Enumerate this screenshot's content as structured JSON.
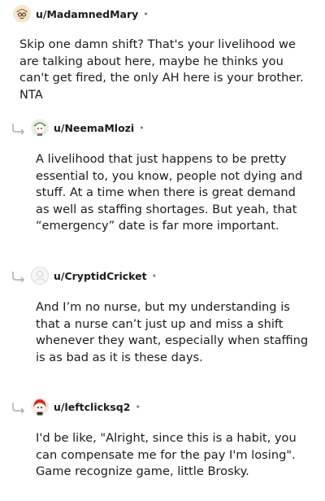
{
  "comments": [
    {
      "username": "u/MadamnedMary",
      "separator": "•",
      "avatar_icon": "snoo-avatar-glasses-icon",
      "text": "Skip one damn shift? That's your livelihood we are talking about here, maybe he thinks you can't get fired, the only AH here is your brother. NTA"
    },
    {
      "username": "u/NeemaMlozi",
      "separator": "•",
      "avatar_icon": "snoo-avatar-green-hat-icon",
      "text": "A livelihood that just happens to be pretty essential to, you know, people not dying and stuff. At a time when there is great demand as well as staffing shortages. But yeah, that “emergency” date is far more important."
    },
    {
      "username": "u/CryptidCricket",
      "separator": "•",
      "avatar_icon": "default-avatar-icon",
      "text": "And I’m no nurse, but my understanding is that a nurse can’t just up and miss a shift whenever they want, especially when staffing is as bad as it is these days."
    },
    {
      "username": "u/leftclicksq2",
      "separator": "•",
      "avatar_icon": "snoo-avatar-red-hair-icon",
      "text": "I'd be like, \"Alright, since this is a habit, you can compensate me for the pay I'm losing\". Game recognize game, little Brosky."
    }
  ]
}
